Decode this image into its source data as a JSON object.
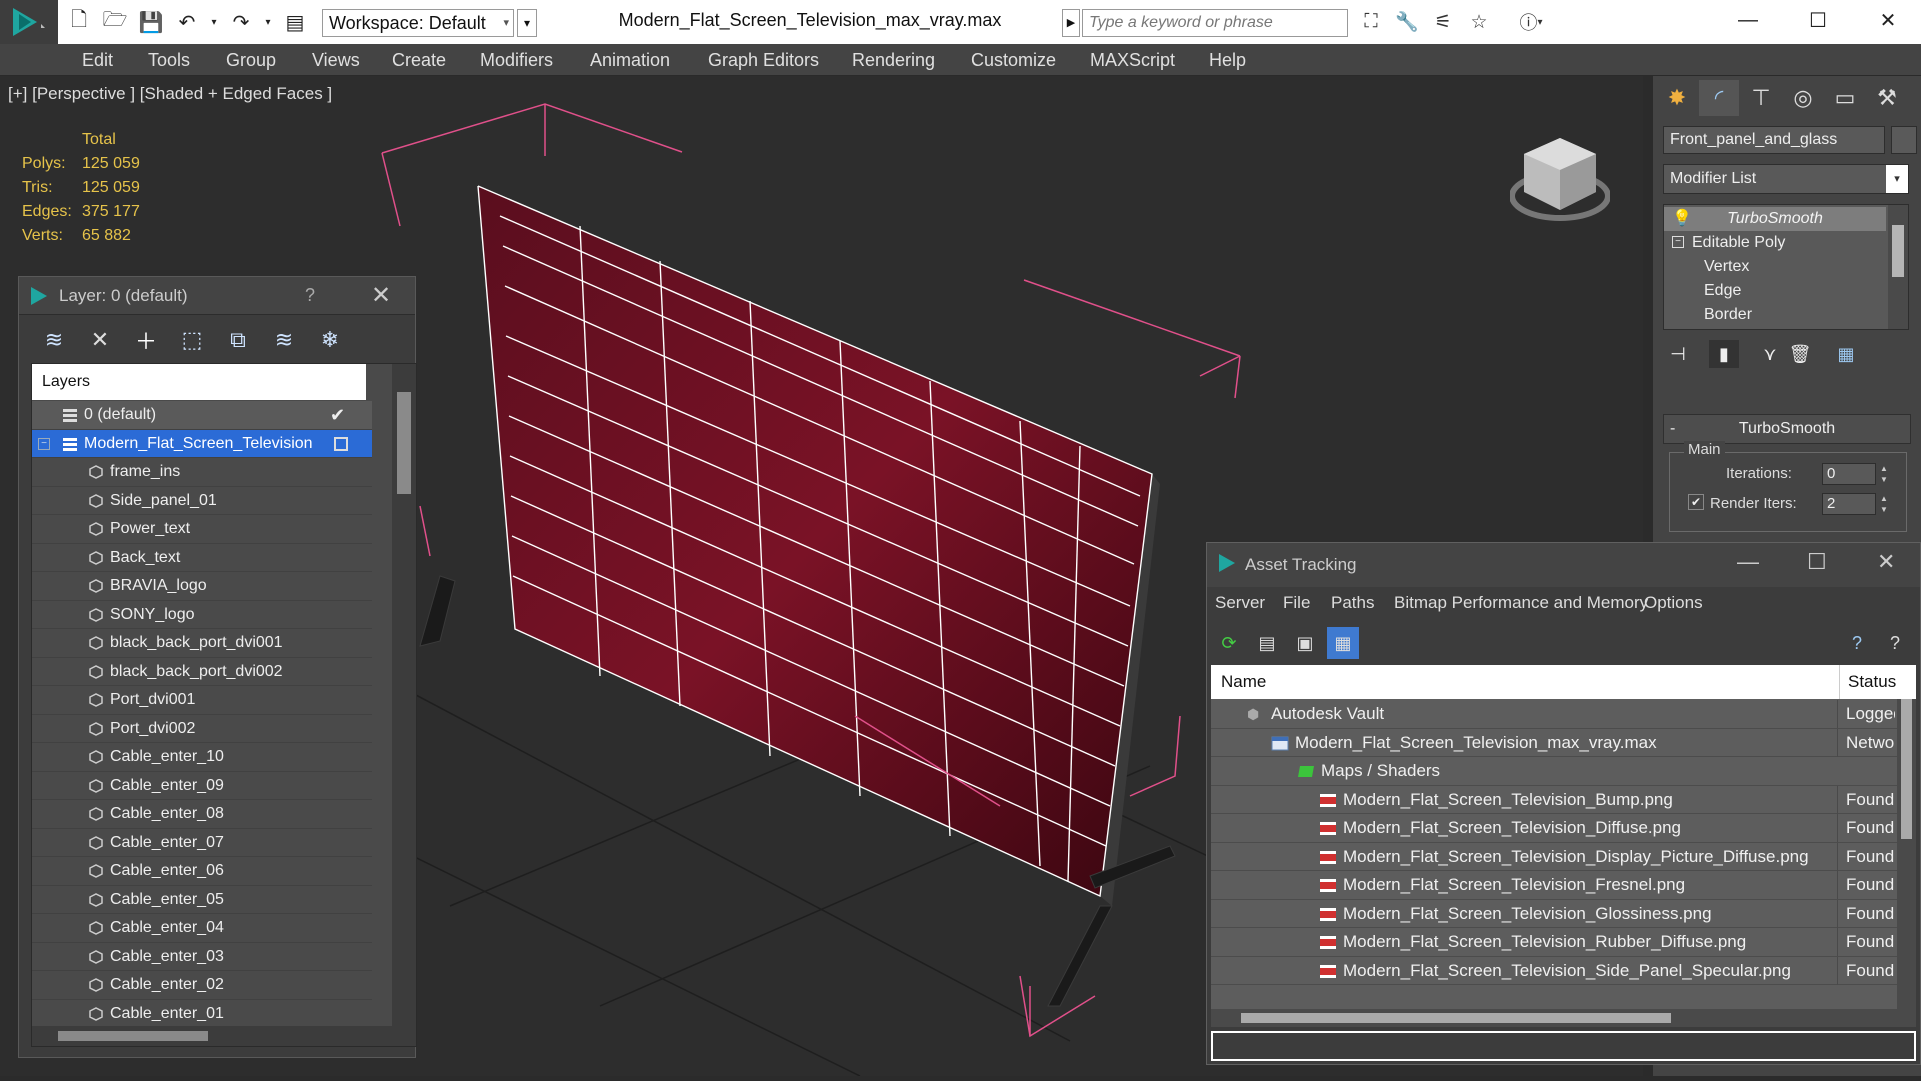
{
  "titlebar": {
    "workspace": "Workspace: Default",
    "document": "Modern_Flat_Screen_Television_max_vray.max",
    "search_placeholder": "Type a keyword or phrase"
  },
  "menu": [
    "Edit",
    "Tools",
    "Group",
    "Views",
    "Create",
    "Modifiers",
    "Animation",
    "Graph Editors",
    "Rendering",
    "Customize",
    "MAXScript",
    "Help"
  ],
  "viewport": {
    "label": "[+] [Perspective ] [Shaded + Edged Faces ]",
    "stats": {
      "header": "Total",
      "rows": [
        {
          "k": "Polys:",
          "v": "125 059"
        },
        {
          "k": "Tris:",
          "v": "125 059"
        },
        {
          "k": "Edges:",
          "v": "375 177"
        },
        {
          "k": "Verts:",
          "v": "65 882"
        }
      ]
    }
  },
  "layer_dialog": {
    "title": "Layer: 0 (default)",
    "help": "?",
    "column": "Layers",
    "rows": [
      "0 (default)",
      "Modern_Flat_Screen_Television",
      "frame_ins",
      "Side_panel_01",
      "Power_text",
      "Back_text",
      "BRAVIA_logo",
      "SONY_logo",
      "black_back_port_dvi001",
      "black_back_port_dvi002",
      "Port_dvi001",
      "Port_dvi002",
      "Cable_enter_10",
      "Cable_enter_09",
      "Cable_enter_08",
      "Cable_enter_07",
      "Cable_enter_06",
      "Cable_enter_05",
      "Cable_enter_04",
      "Cable_enter_03",
      "Cable_enter_02",
      "Cable_enter_01"
    ]
  },
  "command_panel": {
    "object_name": "Front_panel_and_glass",
    "modifier_list": "Modifier List",
    "stack": [
      "TurboSmooth",
      "Editable Poly",
      "Vertex",
      "Edge",
      "Border"
    ],
    "rollout": "TurboSmooth",
    "collapse": "-",
    "group": "Main",
    "iterations_label": "Iterations:",
    "iterations_value": "0",
    "render_iters_label": "Render Iters:",
    "render_iters_value": "2"
  },
  "asset_tracking": {
    "title": "Asset Tracking",
    "menu": [
      "Server",
      "File",
      "Paths",
      "Bitmap Performance and Memory",
      "Options"
    ],
    "col_name": "Name",
    "col_status": "Status",
    "rows": [
      {
        "name": "Autodesk Vault",
        "status": "Logged",
        "icon": "vault-icon"
      },
      {
        "name": "Modern_Flat_Screen_Television_max_vray.max",
        "status": "Networ",
        "icon": "max-file-icon"
      },
      {
        "name": "Maps / Shaders",
        "status": "",
        "icon": "maps-icon"
      },
      {
        "name": "Modern_Flat_Screen_Television_Bump.png",
        "status": "Found",
        "icon": "png-icon"
      },
      {
        "name": "Modern_Flat_Screen_Television_Diffuse.png",
        "status": "Found",
        "icon": "png-icon"
      },
      {
        "name": "Modern_Flat_Screen_Television_Display_Picture_Diffuse.png",
        "status": "Found",
        "icon": "png-icon"
      },
      {
        "name": "Modern_Flat_Screen_Television_Fresnel.png",
        "status": "Found",
        "icon": "png-icon"
      },
      {
        "name": "Modern_Flat_Screen_Television_Glossiness.png",
        "status": "Found",
        "icon": "png-icon"
      },
      {
        "name": "Modern_Flat_Screen_Television_Rubber_Diffuse.png",
        "status": "Found",
        "icon": "png-icon"
      },
      {
        "name": "Modern_Flat_Screen_Television_Side_Panel_Specular.png",
        "status": "Found",
        "icon": "png-icon"
      }
    ]
  },
  "colors": {
    "selection": "#2b6bd6",
    "stats": "#e6c34a",
    "bbox": "#e0508a"
  }
}
